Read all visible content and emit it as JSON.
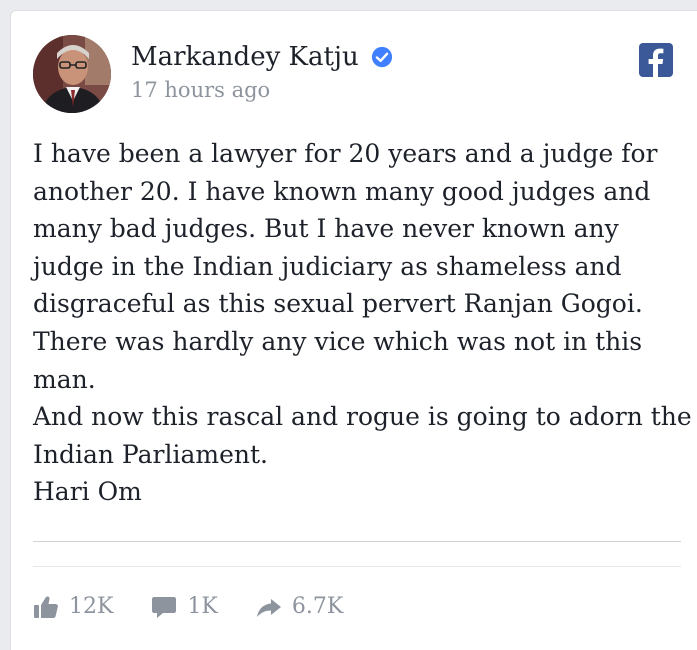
{
  "post": {
    "author": "Markandey Katju",
    "timestamp": "17 hours ago",
    "verified": true,
    "paragraphs": [
      "I have been a lawyer for 20 years and a judge for another 20. I have known many good judges and many bad judges. But I have never known any judge in the Indian judiciary as shameless and disgraceful as this sexual pervert Ranjan Gogoi. There was hardly any vice which was not in this man.",
      "And now this rascal and rogue is going to adorn the Indian Parliament.",
      "Hari Om"
    ]
  },
  "stats": {
    "likes": "12K",
    "comments": "1K",
    "shares": "6.7K"
  },
  "icons": {
    "brand": "facebook-logo-icon",
    "verified": "verified-badge-icon",
    "like": "thumbs-up-icon",
    "comment": "comment-bubble-icon",
    "share": "share-arrow-icon"
  },
  "colors": {
    "facebook_blue": "#3b5998",
    "verified_blue": "#4080ff",
    "muted_text": "#8d949e"
  }
}
